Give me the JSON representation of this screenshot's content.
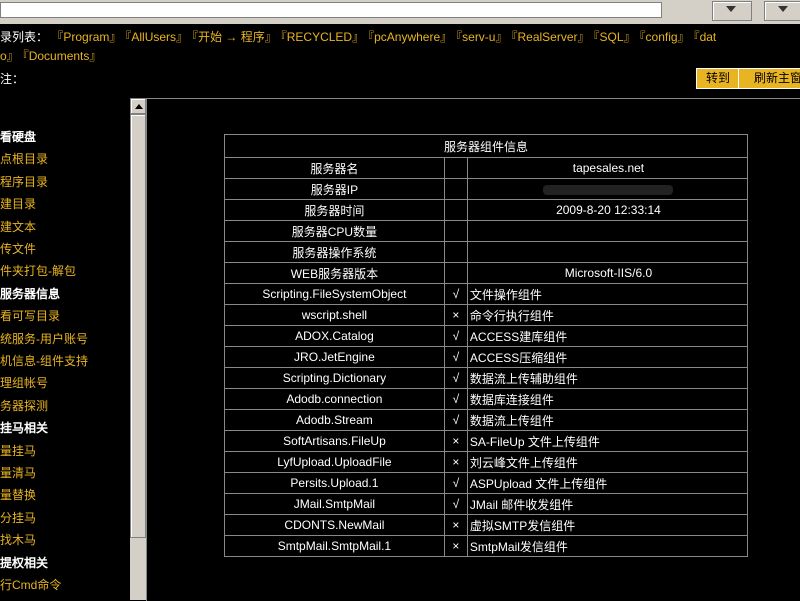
{
  "path_bar": {
    "label": "录列表：",
    "links": [
      "『Program』",
      "『AllUsers』",
      "『开始 → 程序』",
      "『RECYCLED』",
      "『pcAnywhere』",
      "『serv-u』",
      "『RealServer』",
      "『SQL』",
      "『config』",
      "『dat"
    ],
    "links_row2": [
      "o』",
      "『Documents』"
    ]
  },
  "command": {
    "label": "注：",
    "go_label": "转到",
    "refresh_label": "刷新主窗"
  },
  "sidebar": {
    "items": [
      {
        "label": "看硬盘",
        "type": "head"
      },
      {
        "label": "点根目录",
        "type": "link"
      },
      {
        "label": "程序目录",
        "type": "link"
      },
      {
        "label": "建目录",
        "type": "link"
      },
      {
        "label": "建文本",
        "type": "link"
      },
      {
        "label": "传文件",
        "type": "link"
      },
      {
        "label": "件夹打包-解包",
        "type": "link"
      },
      {
        "label": "服务器信息",
        "type": "head"
      },
      {
        "label": "看可写目录",
        "type": "link"
      },
      {
        "label": "统服务-用户账号",
        "type": "link"
      },
      {
        "label": "机信息-组件支持",
        "type": "link"
      },
      {
        "label": "理组帐号",
        "type": "link"
      },
      {
        "label": "务器探测",
        "type": "link"
      },
      {
        "label": "挂马相关",
        "type": "head"
      },
      {
        "label": "量挂马",
        "type": "link"
      },
      {
        "label": "量清马",
        "type": "link"
      },
      {
        "label": "量替换",
        "type": "link"
      },
      {
        "label": "分挂马",
        "type": "link"
      },
      {
        "label": "找木马",
        "type": "link"
      },
      {
        "label": "提权相关",
        "type": "head"
      },
      {
        "label": "行Cmd命令",
        "type": "link"
      }
    ]
  },
  "info_table": {
    "title": "服务器组件信息",
    "info_rows": [
      {
        "name": "服务器名",
        "value": "tapesales.net"
      },
      {
        "name": "服务器IP",
        "value": ""
      },
      {
        "name": "服务器时间",
        "value": "2009-8-20 12:33:14"
      },
      {
        "name": "服务器CPU数量",
        "value": ""
      },
      {
        "name": "服务器操作系统",
        "value": ""
      },
      {
        "name": "WEB服务器版本",
        "value": "Microsoft-IIS/6.0"
      }
    ],
    "component_rows": [
      {
        "name": "Scripting.FileSystemObject",
        "mark": "√",
        "desc": "文件操作组件"
      },
      {
        "name": "wscript.shell",
        "mark": "×",
        "desc": "命令行执行组件"
      },
      {
        "name": "ADOX.Catalog",
        "mark": "√",
        "desc": "ACCESS建库组件"
      },
      {
        "name": "JRO.JetEngine",
        "mark": "√",
        "desc": "ACCESS压缩组件"
      },
      {
        "name": "Scripting.Dictionary",
        "mark": "√",
        "desc": "数据流上传辅助组件"
      },
      {
        "name": "Adodb.connection",
        "mark": "√",
        "desc": "数据库连接组件"
      },
      {
        "name": "Adodb.Stream",
        "mark": "√",
        "desc": "数据流上传组件"
      },
      {
        "name": "SoftArtisans.FileUp",
        "mark": "×",
        "desc": "SA-FileUp 文件上传组件"
      },
      {
        "name": "LyfUpload.UploadFile",
        "mark": "×",
        "desc": "刘云峰文件上传组件"
      },
      {
        "name": "Persits.Upload.1",
        "mark": "√",
        "desc": "ASPUpload 文件上传组件"
      },
      {
        "name": "JMail.SmtpMail",
        "mark": "√",
        "desc": "JMail 邮件收发组件"
      },
      {
        "name": "CDONTS.NewMail",
        "mark": "×",
        "desc": "虚拟SMTP发信组件"
      },
      {
        "name": "SmtpMail.SmtpMail.1",
        "mark": "×",
        "desc": "SmtpMail发信组件"
      }
    ]
  }
}
